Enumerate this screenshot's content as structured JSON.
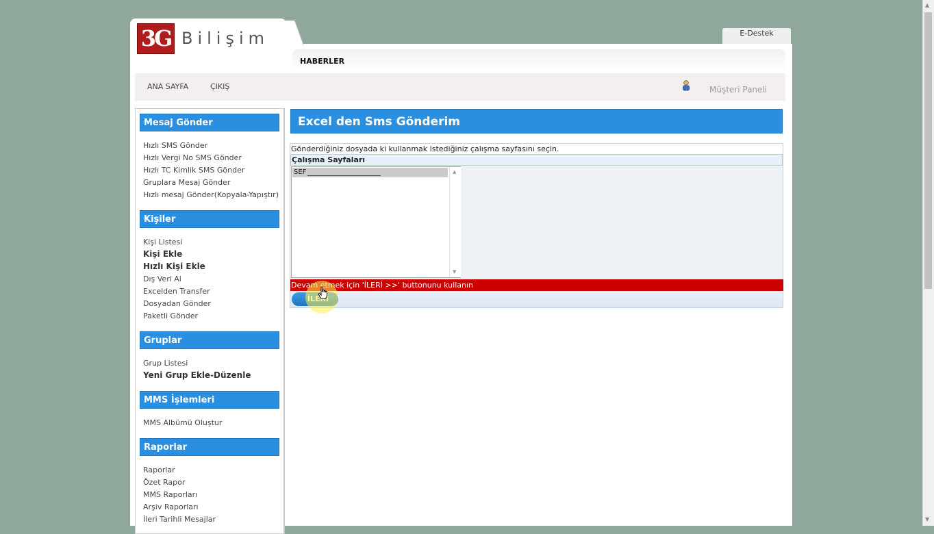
{
  "brand": {
    "logo_mark": "3G",
    "logo_text": "Bilişim"
  },
  "header": {
    "support_tab": "E-Destek",
    "news_label": "HABERLER",
    "nav": {
      "home": "ANA SAYFA",
      "logout": "ÇIKIŞ"
    },
    "customer_panel": "Müşteri Paneli",
    "user_icon": "user-icon"
  },
  "sidebar": {
    "sections": [
      {
        "title": "Mesaj Gönder",
        "items": [
          "Hızlı SMS Gönder",
          "Hızlı Vergi No SMS Gönder",
          "Hızlı TC Kimlik SMS Gönder",
          "Gruplara Mesaj Gönder",
          "Hızlı mesaj Gönder(Kopyala-Yapıştır)"
        ]
      },
      {
        "title": "Kişiler",
        "items": [
          "Kişi Listesi",
          "Kişi Ekle",
          "Hızlı Kişi Ekle",
          "Dış Veri Al",
          "Excelden Transfer",
          "Dosyadan Gönder",
          "Paketli Gönder"
        ]
      },
      {
        "title": "Gruplar",
        "items": [
          "Grup Listesi",
          "Yeni Grup Ekle-Düzenle"
        ]
      },
      {
        "title": "MMS İşlemleri",
        "items": [
          "MMS Albümü Oluştur"
        ]
      },
      {
        "title": "Raporlar",
        "items": [
          "Raporlar",
          "Özet Rapor",
          "MMS Raporları",
          "Arşiv Raporları",
          "İleri Tarihli Mesajlar"
        ]
      }
    ]
  },
  "main": {
    "title": "Excel den Sms Gönderim",
    "instruction": "Gönderdiğiniz dosyada ki kullanmak istediğiniz çalışma sayfasını seçin.",
    "sheets_header": "Çalışma Sayfaları",
    "sheets": [
      "SEF"
    ],
    "selected_sheet": "SEF",
    "warning": "Devam etmek için 'İLERİ >>' buttonunu kullanın",
    "next_button": "İLERİ"
  },
  "colors": {
    "accent": "#2a8fe0",
    "warning": "#cc0000",
    "background": "#8fa89b"
  }
}
